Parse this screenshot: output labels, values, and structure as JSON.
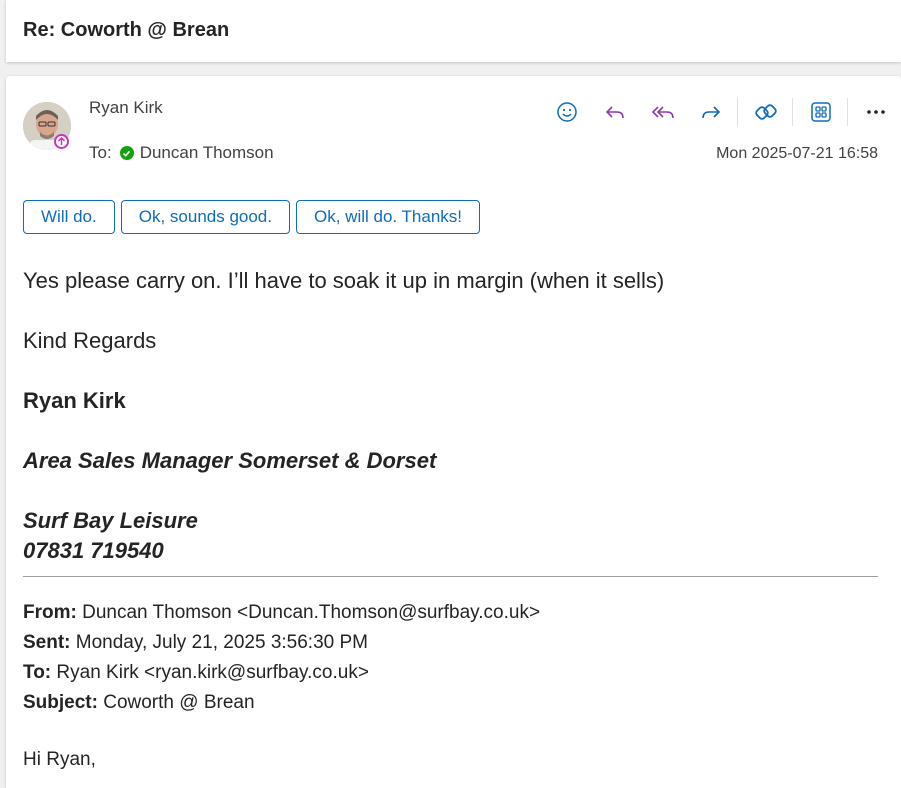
{
  "subject": "Re: Coworth @ Brean",
  "message": {
    "sender": "Ryan Kirk",
    "to_label": "To:",
    "to_name": "Duncan Thomson",
    "date": "Mon 2025-07-21 16:58"
  },
  "quick_replies": [
    "Will do.",
    "Ok, sounds good.",
    "Ok, will do. Thanks!"
  ],
  "body": {
    "line1": "Yes please carry on. I’ll have to soak it up in margin (when it sells)",
    "regards": "Kind Regards",
    "sig_name": "Ryan Kirk",
    "sig_title": "Area Sales Manager Somerset & Dorset",
    "sig_company": "Surf Bay Leisure",
    "sig_phone": "07831 719540"
  },
  "quoted": {
    "from_label": "From:",
    "from_value": " Duncan Thomson <Duncan.Thomson@surfbay.co.uk>",
    "sent_label": "Sent:",
    "sent_value": " Monday, July 21, 2025 3:56:30 PM",
    "to_label": "To:",
    "to_value": " Ryan Kirk <ryan.kirk@surfbay.co.uk>",
    "subject_label": "Subject:",
    "subject_value": " Coworth @ Brean",
    "greeting": "Hi Ryan,"
  },
  "toolbar_icons": [
    "emoji-icon",
    "reply-icon",
    "reply-all-icon",
    "forward-icon",
    "loop-icon",
    "apps-icon",
    "more-icon"
  ],
  "colors": {
    "accent": "#0f6cbd",
    "reply_purple": "#8e3ab0",
    "presence_green": "#13a10e"
  }
}
